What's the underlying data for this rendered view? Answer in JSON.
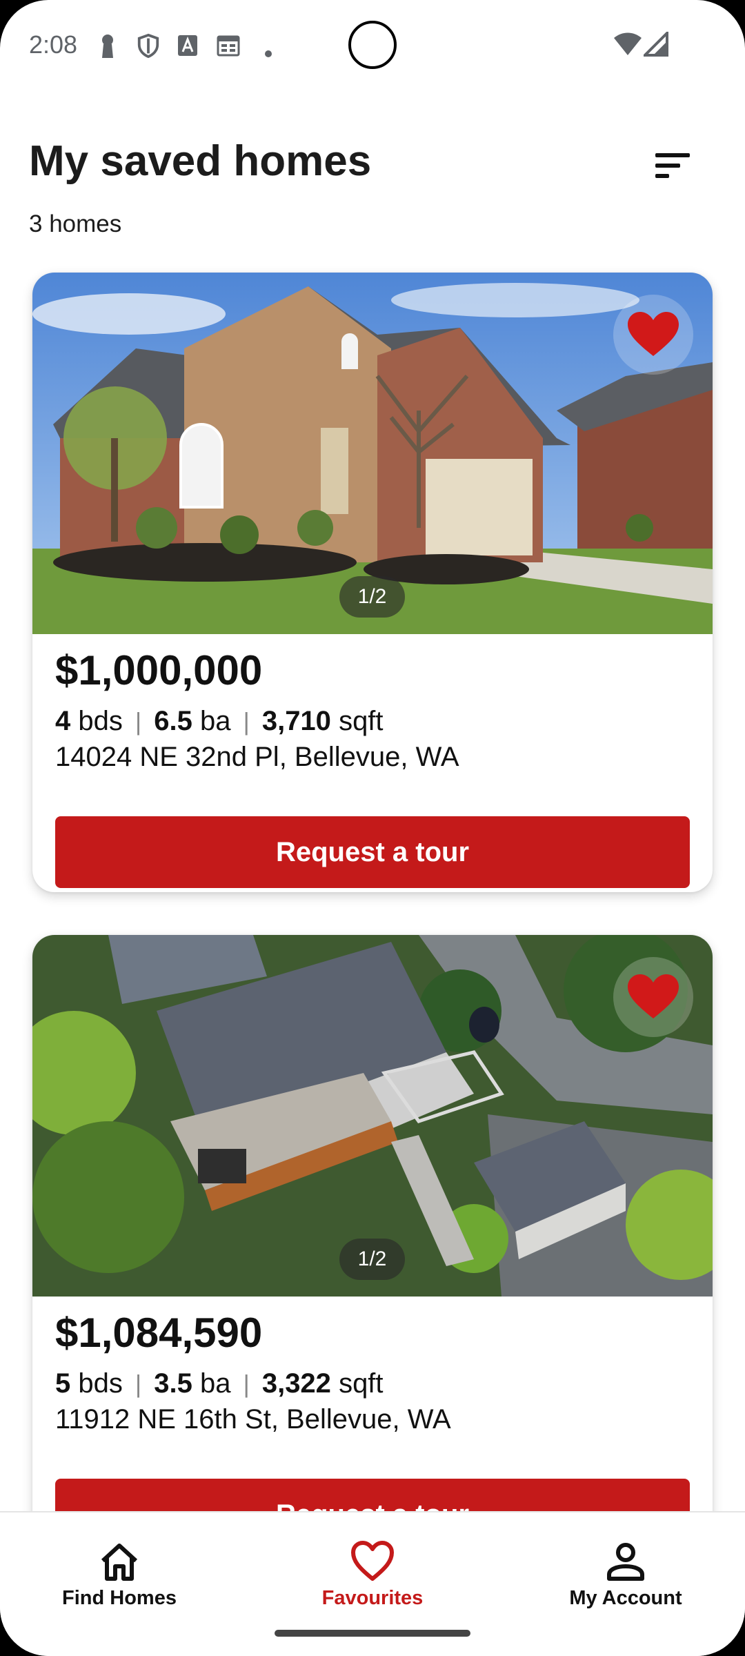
{
  "status_bar": {
    "time": "2:08",
    "icons": [
      "keyhole-icon",
      "shield-icon",
      "font-a-icon",
      "calendar-icon",
      "dot-icon",
      "wifi-icon",
      "signal-icon"
    ]
  },
  "header": {
    "title": "My saved homes",
    "count": "3 homes",
    "sort_icon": "sort-icon"
  },
  "listings": [
    {
      "price": "$1,000,000",
      "beds": "4",
      "beds_unit": "bds",
      "baths": "6.5",
      "baths_unit": "ba",
      "sqft": "3,710",
      "sqft_unit": "sqft",
      "address": "14024 NE 32nd Pl, Bellevue, WA",
      "photo_counter": "1/2",
      "favourited": true,
      "cta": "Request a tour"
    },
    {
      "price": "$1,084,590",
      "beds": "5",
      "beds_unit": "bds",
      "baths": "3.5",
      "baths_unit": "ba",
      "sqft": "3,322",
      "sqft_unit": "sqft",
      "address": "11912 NE 16th St, Bellevue, WA",
      "photo_counter": "1/2",
      "favourited": true,
      "cta": "Request a tour"
    }
  ],
  "nav": {
    "find_homes": "Find Homes",
    "favourites": "Favourites",
    "my_account": "My Account",
    "active": "favourites"
  },
  "colors": {
    "accent": "#c41a1a",
    "text": "#111111",
    "muted": "#5f6368"
  }
}
